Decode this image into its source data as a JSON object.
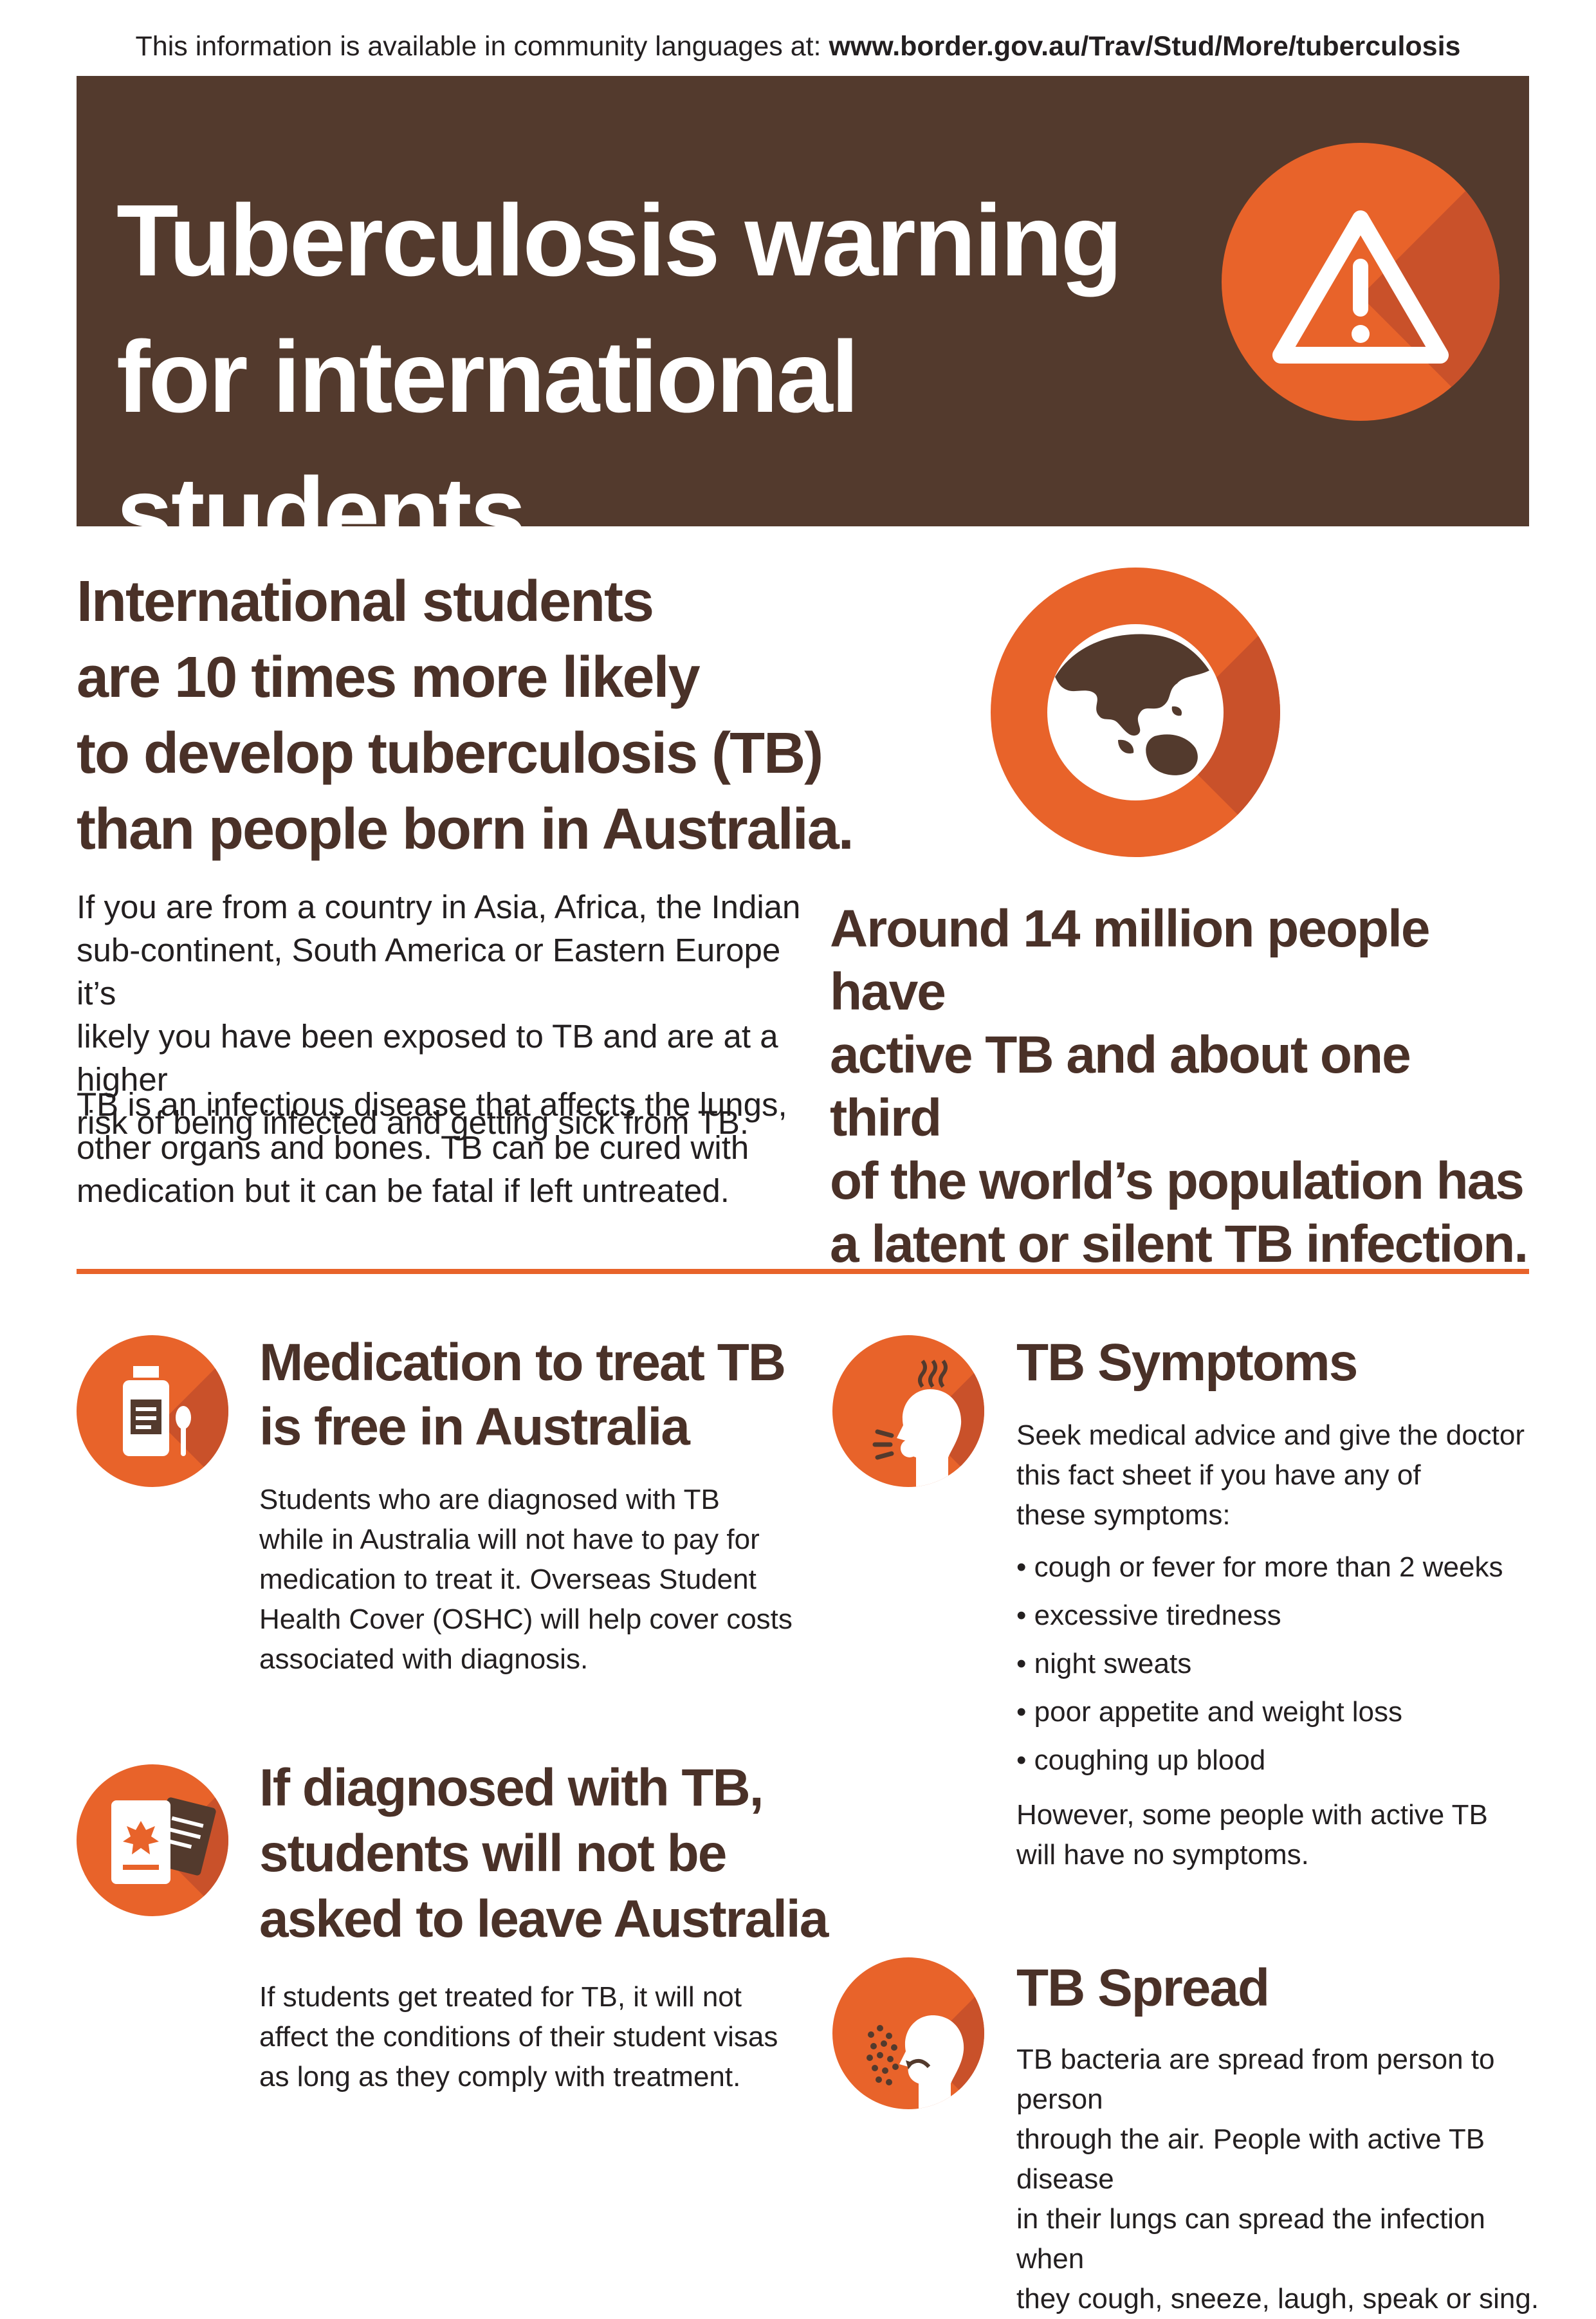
{
  "top_note": {
    "text": "This information is available in community languages at: ",
    "url": "www.border.gov.au/Trav/Stud/More/tuberculosis"
  },
  "banner": {
    "title_line1": "Tuberculosis warning",
    "title_line2": "for international students",
    "icon": "warning-triangle-icon"
  },
  "intro": {
    "headline_lines": [
      "International students",
      "are 10 times more likely",
      "to develop tuberculosis (TB)",
      "than people born in Australia."
    ],
    "paragraph1_lines": [
      "If you are from a country in Asia, Africa, the Indian",
      "sub-continent, South America or Eastern Europe it’s",
      "likely you have been exposed to TB and are at a higher",
      "risk of being infected and getting sick from TB."
    ],
    "paragraph2_lines": [
      "TB is an infectious disease that affects the lungs,",
      "other organs and bones. TB can be cured with",
      "medication but it can be fatal if left untreated."
    ]
  },
  "world": {
    "icon": "globe-icon",
    "statement_lines": [
      "Around 14 million people have",
      "active TB and about one third",
      "of the world’s population has",
      "a latent or silent TB infection."
    ]
  },
  "medication": {
    "icon": "medicine-bottle-icon",
    "title_lines": [
      "Medication to treat TB",
      "is free in Australia"
    ],
    "body_lines": [
      "Students who are diagnosed with TB",
      "while in Australia will not have to pay for",
      "medication to treat it. Overseas Student",
      "Health Cover (OSHC) will help cover costs",
      "associated with diagnosis."
    ]
  },
  "diagnosed": {
    "icon": "passport-icon",
    "title_lines": [
      "If diagnosed with TB,",
      "students will not be",
      "asked to leave Australia"
    ],
    "body_lines": [
      "If students get treated for TB, it will not",
      "affect the conditions of their student visas",
      "as long as they comply with treatment."
    ]
  },
  "symptoms": {
    "icon": "coughing-person-icon",
    "title": "TB Symptoms",
    "intro_lines": [
      "Seek medical advice and give the doctor",
      "this fact sheet if you have any of",
      "these symptoms:"
    ],
    "items": [
      "• cough or fever for more than 2 weeks",
      "• excessive tiredness",
      "• night sweats",
      "• poor appetite and weight loss",
      "• coughing up blood"
    ],
    "note_lines": [
      "However, some people with active TB",
      "will have no symptoms."
    ]
  },
  "spread": {
    "icon": "sneezing-person-icon",
    "title": "TB Spread",
    "body_lines": [
      "TB bacteria are spread from person to person",
      "through the air. People with active TB disease",
      "in their lungs can spread the infection when",
      "they cough, sneeze, laugh, speak or sing."
    ]
  },
  "colors": {
    "brown": "#533a2d",
    "orange": "#e8632a",
    "dark_orange": "#c9512a"
  }
}
